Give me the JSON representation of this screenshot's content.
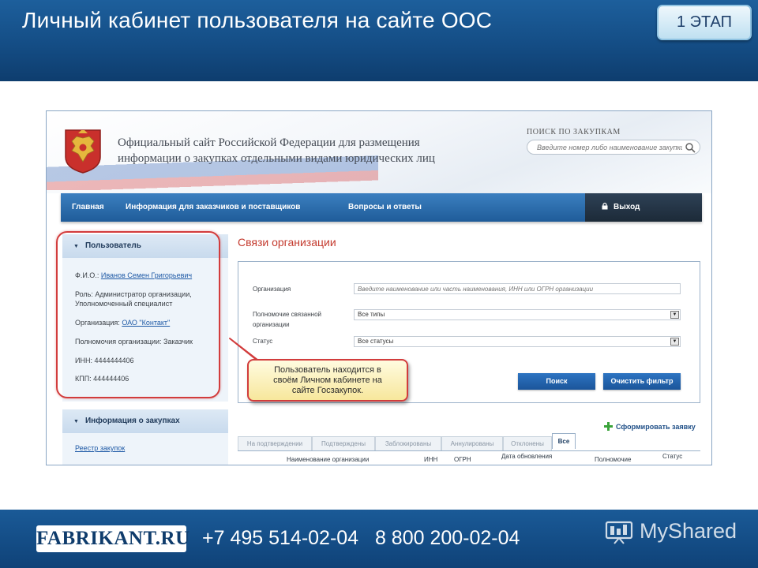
{
  "slide": {
    "title": "Личный кабинет пользователя на сайте ООС",
    "stage_button": "1 ЭТАП"
  },
  "site": {
    "title_line1": "Официальный сайт Российской Федерации для размещения",
    "title_line2": "информации о закупках отдельными видами юридических лиц",
    "search_label": "ПОИСК ПО ЗАКУПКАМ",
    "search_placeholder": "Введите номер либо наименование закупки",
    "nav": {
      "items": [
        "Главная",
        "Информация для заказчиков и поставщиков",
        "Вопросы и ответы"
      ],
      "exit": "Выход"
    }
  },
  "user_panel": {
    "header": "Пользователь",
    "fio_label": "Ф.И.О.:",
    "fio_value": "Иванов Семен Григорьевич",
    "role_line1": "Роль: Администратор организации,",
    "role_line2": "Уполномоченный специалист",
    "org_label": "Организация:",
    "org_value": "ОАО \"Контакт\"",
    "authority": "Полномочия организации: Заказчик",
    "inn": "ИНН: 4444444406",
    "kpp": "КПП: 444444406"
  },
  "info_panel": {
    "header": "Информация о закупках",
    "link": "Реестр закупок"
  },
  "main": {
    "section_title": "Связи организации",
    "filters": {
      "org_label": "Организация",
      "org_placeholder": "Введите наименование или часть наименования, ИНН или ОГРН организации",
      "authority_label_1": "Полномочие связанной",
      "authority_label_2": "организации",
      "authority_value": "Все типы",
      "status_label": "Статус",
      "status_value": "Все статусы"
    },
    "search_button": "Поиск",
    "clear_button": "Очистить фильтр",
    "form_request": "Сформировать заявку",
    "tabs": [
      "На подтверждении",
      "Подтверждены",
      "Заблокированы",
      "Аннулированы",
      "Отклонены",
      "Все"
    ],
    "columns": [
      "Наименование организации",
      "ИНН",
      "ОГРН",
      "Дата обновления",
      "Полномочие",
      "Статус"
    ]
  },
  "callout": {
    "line1": "Пользователь находится в",
    "line2": "своём Личном кабинете на",
    "line3": "сайте Госзакупок."
  },
  "footer": {
    "brand": "FABRIKANT.RU",
    "phone1": "+7 495 514-02-04",
    "phone2": "8 800 200-02-04",
    "watermark": "MyShared"
  },
  "colors": {
    "banner": "#144d85",
    "nav": "#1f5c99",
    "section_title": "#c43a2e",
    "callout_border": "#d23c3c",
    "link": "#1f5aa6"
  },
  "icons": [
    "coat-of-arms-icon",
    "search-icon",
    "lock-icon",
    "caret-down-icon",
    "plus-icon",
    "select-arrow-icon",
    "myshared-logo-icon"
  ]
}
